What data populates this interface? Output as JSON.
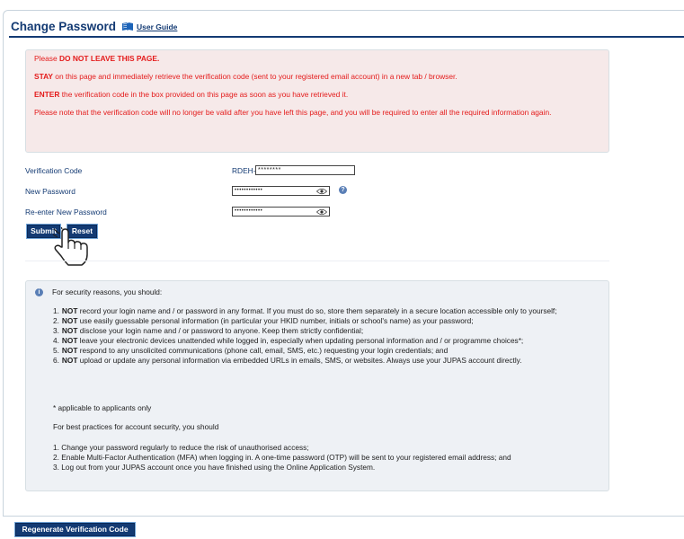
{
  "header": {
    "title": "Change Password",
    "guide_link": "User Guide"
  },
  "warning": {
    "line1_pre": "Please ",
    "line1_bold": "DO NOT LEAVE THIS PAGE.",
    "line2_bold": "STAY",
    "line2_rest": " on this page and immediately retrieve the verification code (sent to your registered email account) in a new tab / browser.",
    "line3_bold": "ENTER",
    "line3_rest": " the verification code in the box provided on this page as soon as you have retrieved it.",
    "line4": "Please note that the verification code will no longer be valid after you have left this page, and you will be required to enter all the required information again."
  },
  "form": {
    "verification_label": "Verification Code",
    "verification_prefix": "RDEH-",
    "verification_value": "********",
    "new_password_label": "New Password",
    "new_password_value": "••••••••••••",
    "reenter_label": "Re-enter New Password",
    "reenter_value": "••••••••••••",
    "help_icon_text": "?",
    "submit_label": "Submit",
    "reset_label": "Reset"
  },
  "security": {
    "info_icon_text": "i",
    "intro": "For security reasons, you should:",
    "rules": [
      {
        "num": "1.",
        "bold": "NOT",
        "text": " record your login name and / or password in any format. If you must do so, store them separately in a secure location accessible only to yourself;"
      },
      {
        "num": "2.",
        "bold": "NOT",
        "text": " use easily guessable personal information (in particular your HKID number, initials or school's name) as your password;"
      },
      {
        "num": "3.",
        "bold": "NOT",
        "text": " disclose your login name and / or password to anyone. Keep them strictly confidential;"
      },
      {
        "num": "4.",
        "bold": "NOT",
        "text": " leave your electronic devices unattended while logged in, especially when updating personal information and / or programme choices*;"
      },
      {
        "num": "5.",
        "bold": "NOT",
        "text": " respond to any unsolicited communications (phone call, email, SMS, etc.) requesting your login credentials; and"
      },
      {
        "num": "6.",
        "bold": "NOT",
        "text": " upload or update any personal information via embedded URLs in emails, SMS, or websites. Always use your JUPAS account directly."
      }
    ],
    "note": "* applicable to applicants only",
    "best_intro": "For best practices for account security, you should",
    "best": [
      "1. Change your password regularly to reduce the risk of unauthorised access;",
      "2. Enable Multi-Factor Authentication (MFA) when logging in. A one-time password (OTP) will be sent to your registered email address; and",
      "3. Log out from your JUPAS account once you have finished using the Online Application System."
    ]
  },
  "footer": {
    "regenerate_label": "Regenerate Verification Code"
  },
  "colors": {
    "brand": "#133a73",
    "warning_text": "#e41b1b",
    "warning_bg": "#f6e9e9",
    "info_bg": "#eef1f5"
  }
}
